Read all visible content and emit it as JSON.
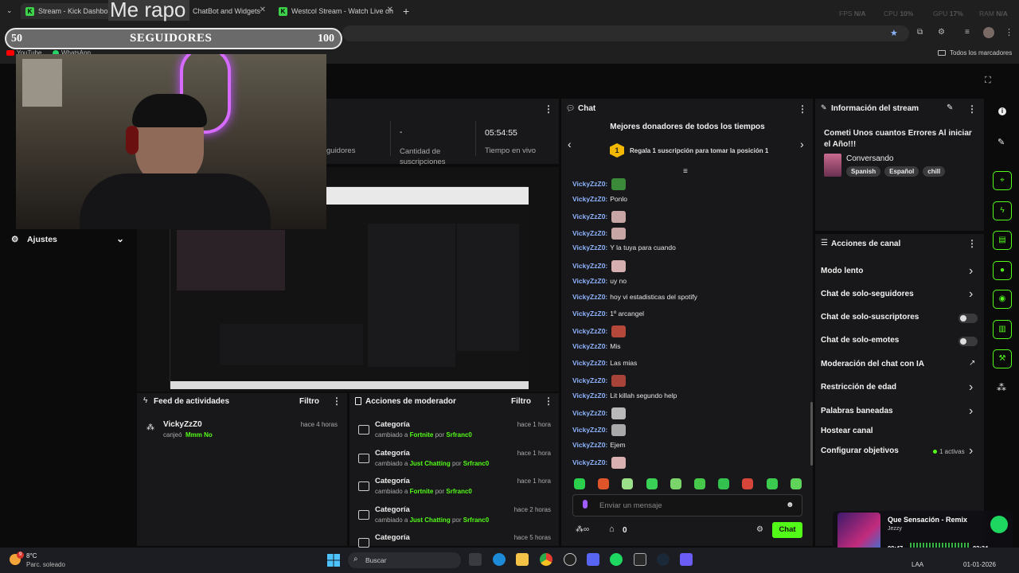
{
  "browser": {
    "tabs": [
      {
        "label": "Stream - Kick Dashboard"
      },
      {
        "label": "ChatBot and Widgets"
      },
      {
        "label": "Westcol Stream - Watch Live on"
      }
    ],
    "overlay_text": "Me rapo",
    "bookmarks": [
      "YouTube",
      "WhatsApp"
    ],
    "all_bookmarks": "Todos los marcadores",
    "stats": {
      "fps_label": "FPS",
      "fps": "N/A",
      "cpu_label": "CPU",
      "cpu": "10%",
      "gpu_label": "GPU",
      "gpu": "17%",
      "ram_label": "RAM",
      "ram": "N/A"
    }
  },
  "follower_goal": {
    "start": "50",
    "label": "SEGUIDORES",
    "end": "100",
    "progress": 0.0
  },
  "left_nav": {
    "settings_label": "Ajustes"
  },
  "stats_panel": {
    "followers_label": "guidores",
    "subs_value": "-",
    "subs_label": "Cantidad de suscripciones",
    "live_value": "05:54:55",
    "live_label": "Tiempo en vivo"
  },
  "activity_feed": {
    "title": "Feed de actividades",
    "filter": "Filtro",
    "items": [
      {
        "user": "VickyZzZ0",
        "action": "canjeó",
        "reward": "Mmm No",
        "time": "hace 4 horas"
      }
    ]
  },
  "mod_actions": {
    "title": "Acciones de moderador",
    "filter": "Filtro",
    "rows": [
      {
        "title": "Categoría",
        "prefix": "cambiado a",
        "value": "Fortnite",
        "by": "por",
        "mod": "Srfranc0",
        "time": "hace 1 hora"
      },
      {
        "title": "Categoría",
        "prefix": "cambiado a",
        "value": "Just Chatting",
        "by": "por",
        "mod": "Srfranc0",
        "time": "hace 1 hora"
      },
      {
        "title": "Categoría",
        "prefix": "cambiado a",
        "value": "Fortnite",
        "by": "por",
        "mod": "Srfranc0",
        "time": "hace 1 hora"
      },
      {
        "title": "Categoría",
        "prefix": "cambiado a",
        "value": "Just Chatting",
        "by": "por",
        "mod": "Srfranc0",
        "time": "hace 2 horas"
      },
      {
        "title": "Categoría",
        "prefix": "",
        "value": "",
        "by": "",
        "mod": "",
        "time": "hace 5 horas"
      }
    ]
  },
  "chat": {
    "title": "Chat",
    "donors_title": "Mejores donadores de todos los tiempos",
    "donor_rank": "1",
    "donor_text": "Regala 1 suscripción para tomar la posición 1",
    "messages": [
      {
        "user": "VickyZzZ0:",
        "text": "",
        "emote": "#3a8a3a"
      },
      {
        "user": "VickyZzZ0:",
        "text": "Ponlo",
        "emote": ""
      },
      {
        "user": "VickyZzZ0:",
        "text": "",
        "emote": "#c9a6a6"
      },
      {
        "user": "VickyZzZ0:",
        "text": "",
        "emote": "#c9a6a6"
      },
      {
        "user": "VickyZzZ0:",
        "text": "Y la tuya para cuando",
        "emote": ""
      },
      {
        "user": "VickyZzZ0:",
        "text": "",
        "emote": "#d6b0b0"
      },
      {
        "user": "VickyZzZ0:",
        "text": "uy no",
        "emote": ""
      },
      {
        "user": "VickyZzZ0:",
        "text": "hoy vi estadisticas del spotify",
        "emote": ""
      },
      {
        "user": "VickyZzZ0:",
        "text": "1º arcangel",
        "emote": ""
      },
      {
        "user": "VickyZzZ0:",
        "text": "",
        "emote": "#b5483a"
      },
      {
        "user": "VickyZzZ0:",
        "text": "Mis",
        "emote": ""
      },
      {
        "user": "VickyZzZ0:",
        "text": "Las mias",
        "emote": ""
      },
      {
        "user": "VickyZzZ0:",
        "text": "",
        "emote": "#a8433a"
      },
      {
        "user": "VickyZzZ0:",
        "text": "Lit killah segundo help",
        "emote": ""
      },
      {
        "user": "VickyZzZ0:",
        "text": "",
        "emote": "#b9b9b9"
      },
      {
        "user": "VickyZzZ0:",
        "text": "",
        "emote": "#a9a9a9"
      },
      {
        "user": "VickyZzZ0:",
        "text": "Ejem",
        "emote": ""
      },
      {
        "user": "VickyZzZ0:",
        "text": "",
        "emote": "#d8b0b0"
      }
    ],
    "input_placeholder": "Enviar un mensaje",
    "points": "0",
    "send_label": "Chat"
  },
  "stream_info": {
    "title_label": "Información del stream",
    "stream_title": "Cometi Unos cuantos Errores Al iniciar el Año!!!",
    "category": "Conversando",
    "tags": [
      "Spanish",
      "Español",
      "chill"
    ]
  },
  "channel_actions": {
    "title": "Acciones de canal",
    "items": [
      {
        "label": "Modo lento",
        "control": "chevron"
      },
      {
        "label": "Chat de solo-seguidores",
        "control": "chevron"
      },
      {
        "label": "Chat de solo-suscriptores",
        "control": "toggle"
      },
      {
        "label": "Chat de solo-emotes",
        "control": "toggle"
      },
      {
        "label": "Moderación del chat con IA",
        "control": "external"
      },
      {
        "label": "Restricción de edad",
        "control": "chevron"
      },
      {
        "label": "Palabras baneadas",
        "control": "chevron"
      },
      {
        "label": "Hostear canal",
        "control": "none"
      },
      {
        "label": "Configurar objetivos",
        "control": "chevron"
      }
    ],
    "goals_active": "1 activas"
  },
  "spotify": {
    "title": "Que Sensación - Remix",
    "artist": "Jezzy",
    "elapsed": "00:47",
    "total": "02:34"
  },
  "taskbar": {
    "weather_temp": "8°C",
    "weather_desc": "Parc. soleado",
    "weather_badge": "9",
    "search_placeholder": "Buscar",
    "lang": "LAA",
    "date": "01-01-2026"
  }
}
